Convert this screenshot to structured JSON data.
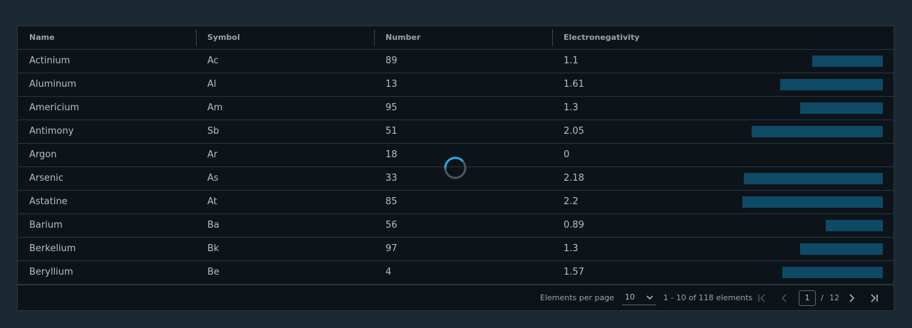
{
  "columns": [
    "Name",
    "Symbol",
    "Number",
    "Electronegativity"
  ],
  "rows": [
    {
      "name": "Actinium",
      "symbol": "Ac",
      "number": "89",
      "electronegativity": "1.1"
    },
    {
      "name": "Aluminum",
      "symbol": "Al",
      "number": "13",
      "electronegativity": "1.61"
    },
    {
      "name": "Americium",
      "symbol": "Am",
      "number": "95",
      "electronegativity": "1.3"
    },
    {
      "name": "Antimony",
      "symbol": "Sb",
      "number": "51",
      "electronegativity": "2.05"
    },
    {
      "name": "Argon",
      "symbol": "Ar",
      "number": "18",
      "electronegativity": "0"
    },
    {
      "name": "Arsenic",
      "symbol": "As",
      "number": "33",
      "electronegativity": "2.18"
    },
    {
      "name": "Astatine",
      "symbol": "At",
      "number": "85",
      "electronegativity": "2.2"
    },
    {
      "name": "Barium",
      "symbol": "Ba",
      "number": "56",
      "electronegativity": "0.89"
    },
    {
      "name": "Berkelium",
      "symbol": "Bk",
      "number": "97",
      "electronegativity": "1.3"
    },
    {
      "name": "Beryllium",
      "symbol": "Be",
      "number": "4",
      "electronegativity": "1.57"
    }
  ],
  "bar_max_value": 2.2,
  "colors": {
    "background": "#1b2a32",
    "grid": "#0d1419",
    "bar": "#0e4a66",
    "spinner": "#2ea3dc"
  },
  "footer": {
    "per_page_label": "Elements per page",
    "per_page_value": "10",
    "range_text": "1 - 10 of 118 elements",
    "current_page": "1",
    "page_separator": "/",
    "total_pages": "12"
  },
  "icons": {
    "first": "first-page-icon",
    "prev": "previous-page-icon",
    "next": "next-page-icon",
    "last": "last-page-icon",
    "dropdown": "chevron-down-icon",
    "loading": "loading-spinner-icon"
  }
}
